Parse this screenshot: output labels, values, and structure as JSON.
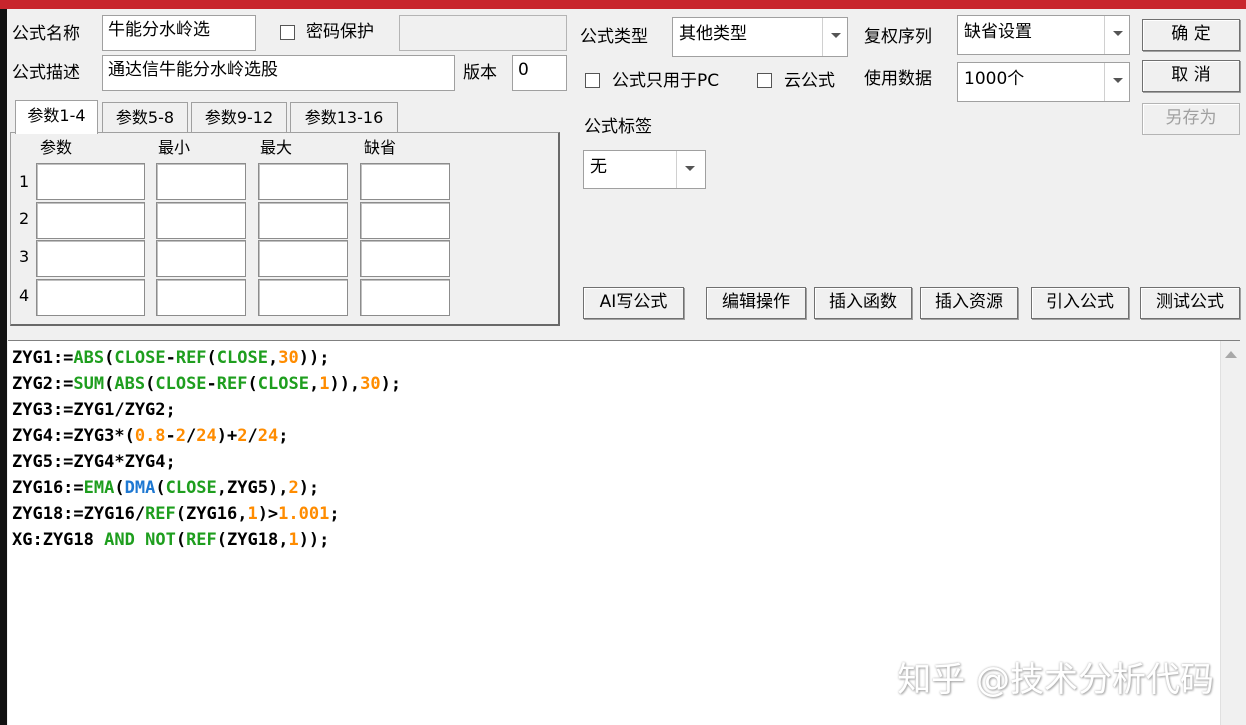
{
  "form": {
    "name_label": "公式名称",
    "name_value": "牛能分水岭选",
    "password_label": "密码保护",
    "password_value": "",
    "desc_label": "公式描述",
    "desc_value": "通达信牛能分水岭选股",
    "version_label": "版本",
    "version_value": "0",
    "type_label": "公式类型",
    "type_value": "其他类型",
    "restore_label": "复权序列",
    "restore_value": "缺省设置",
    "pc_only_label": "公式只用于PC",
    "cloud_label": "云公式",
    "usedata_label": "使用数据",
    "usedata_value": "1000个",
    "tag_label": "公式标签",
    "tag_value": "无"
  },
  "buttons": {
    "ok": "确  定",
    "cancel": "取  消",
    "save_as": "另存为",
    "ai_write": "AI写公式",
    "edit_ops": "编辑操作",
    "insert_func": "插入函数",
    "insert_res": "插入资源",
    "import_formula": "引入公式",
    "test_formula": "测试公式"
  },
  "tabs": [
    "参数1-4",
    "参数5-8",
    "参数9-12",
    "参数13-16"
  ],
  "params": {
    "headers": [
      "参数",
      "最小",
      "最大",
      "缺省"
    ],
    "rows": [
      "1",
      "2",
      "3",
      "4"
    ]
  },
  "code_colors": {
    "default": "#000000",
    "function": "#1e9e1e",
    "keyword": "#1e9e1e",
    "number": "#ff8c00",
    "dma": "#1e78d2"
  },
  "code": [
    [
      [
        "ZYG1:=",
        "d"
      ],
      [
        "ABS",
        "f"
      ],
      [
        "(",
        "d"
      ],
      [
        "CLOSE",
        "f"
      ],
      [
        "-",
        "d"
      ],
      [
        "REF",
        "f"
      ],
      [
        "(",
        "d"
      ],
      [
        "CLOSE",
        "f"
      ],
      [
        ",",
        "d"
      ],
      [
        "30",
        "n"
      ],
      [
        "));",
        "d"
      ]
    ],
    [
      [
        "ZYG2:=",
        "d"
      ],
      [
        "SUM",
        "f"
      ],
      [
        "(",
        "d"
      ],
      [
        "ABS",
        "f"
      ],
      [
        "(",
        "d"
      ],
      [
        "CLOSE",
        "f"
      ],
      [
        "-",
        "d"
      ],
      [
        "REF",
        "f"
      ],
      [
        "(",
        "d"
      ],
      [
        "CLOSE",
        "f"
      ],
      [
        ",",
        "d"
      ],
      [
        "1",
        "n"
      ],
      [
        ")),",
        "d"
      ],
      [
        "30",
        "n"
      ],
      [
        ");",
        "d"
      ]
    ],
    [
      [
        "ZYG3:=ZYG1/ZYG2;",
        "d"
      ]
    ],
    [
      [
        "ZYG4:=ZYG3*(",
        "d"
      ],
      [
        "0.8",
        "n"
      ],
      [
        "-",
        "d"
      ],
      [
        "2",
        "n"
      ],
      [
        "/",
        "d"
      ],
      [
        "24",
        "n"
      ],
      [
        ")+",
        "d"
      ],
      [
        "2",
        "n"
      ],
      [
        "/",
        "d"
      ],
      [
        "24",
        "n"
      ],
      [
        ";",
        "d"
      ]
    ],
    [
      [
        "ZYG5:=ZYG4*ZYG4;",
        "d"
      ]
    ],
    [
      [
        "ZYG16:=",
        "d"
      ],
      [
        "EMA",
        "f"
      ],
      [
        "(",
        "d"
      ],
      [
        "DMA",
        "b"
      ],
      [
        "(",
        "d"
      ],
      [
        "CLOSE",
        "f"
      ],
      [
        ",ZYG5),",
        "d"
      ],
      [
        "2",
        "n"
      ],
      [
        ");",
        "d"
      ]
    ],
    [
      [
        "ZYG18:=ZYG16/",
        "d"
      ],
      [
        "REF",
        "f"
      ],
      [
        "(ZYG16,",
        "d"
      ],
      [
        "1",
        "n"
      ],
      [
        ")>",
        "d"
      ],
      [
        "1.001",
        "n"
      ],
      [
        ";",
        "d"
      ]
    ],
    [
      [
        "XG:ZYG18 ",
        "d"
      ],
      [
        "AND",
        "k"
      ],
      [
        " ",
        "d"
      ],
      [
        "NOT",
        "k"
      ],
      [
        "(",
        "d"
      ],
      [
        "REF",
        "f"
      ],
      [
        "(ZYG18,",
        "d"
      ],
      [
        "1",
        "n"
      ],
      [
        "));",
        "d"
      ]
    ]
  ],
  "watermark": "知乎 @技术分析代码"
}
